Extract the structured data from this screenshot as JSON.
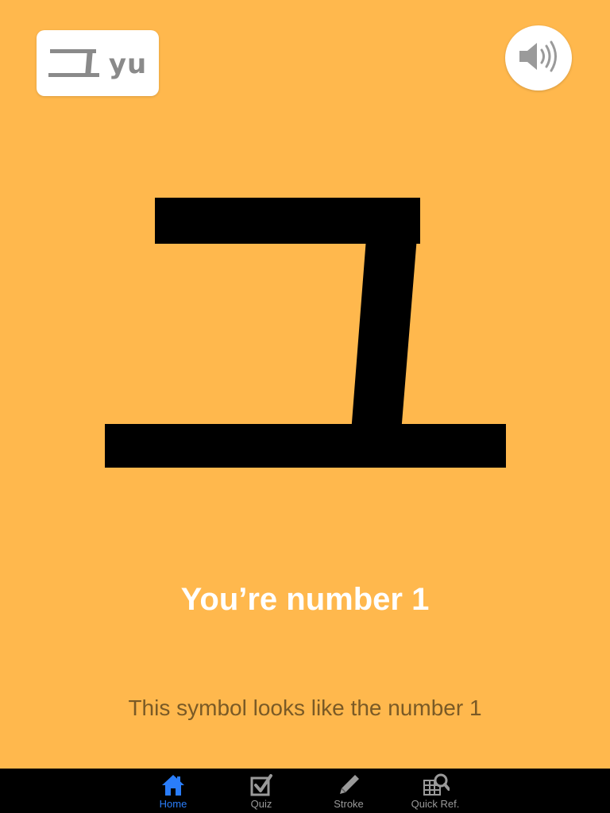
{
  "header": {
    "character": "ㅠ",
    "romanization": "yu",
    "sound_icon": "speaker-icon"
  },
  "lesson": {
    "symbol": "ㅠ",
    "caption": "You’re number 1",
    "description": "This symbol looks like the number 1"
  },
  "tabs": [
    {
      "label": "Home",
      "icon": "home-icon",
      "active": true
    },
    {
      "label": "Quiz",
      "icon": "checkbox-icon",
      "active": false
    },
    {
      "label": "Stroke",
      "icon": "pencil-icon",
      "active": false
    },
    {
      "label": "Quick Ref.",
      "icon": "grid-search-icon",
      "active": false
    }
  ],
  "colors": {
    "background": "#FFB84D",
    "accent_active": "#2a7dfa",
    "tab_inactive": "#9a9a9a",
    "tabbar": "#000000"
  }
}
